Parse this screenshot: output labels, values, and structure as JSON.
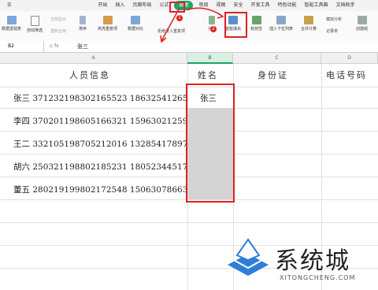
{
  "tabs": [
    "开始",
    "插入",
    "页面布局",
    "公式",
    "数据",
    "审阅",
    "视图",
    "安全",
    "开发工具",
    "特色功能",
    "智能工具箱",
    "文档助手"
  ],
  "active_tab": "数据",
  "ribbon": {
    "pivot": "数据透视表",
    "autofilter": "自动筛选",
    "show_all": "全部显示",
    "reapply": "重新应用",
    "sort": "排序",
    "highlight_dup": "高亮重复项",
    "data_compare": "数据对比",
    "reject_dup": "拒绝录入重复项",
    "split": "分列",
    "flash_fill": "智能填充",
    "validity": "有效性",
    "dropdown": "插入下拉列表",
    "merge_calc": "合并计算",
    "simulate": "模拟分析",
    "record": "记录单",
    "create_group": "创建组"
  },
  "formula_bar": {
    "cell_ref": "B2",
    "fx": "fx",
    "value": "张三"
  },
  "columns": [
    "A",
    "B",
    "C",
    "D"
  ],
  "headers": {
    "a": "人员信息",
    "b": "姓名",
    "c": "身份证",
    "d": "电话号码"
  },
  "rows": [
    {
      "info": "张三  371232198302165523  18632541265",
      "name": "张三"
    },
    {
      "info": "李四  370201198605166321  15963021259",
      "name": ""
    },
    {
      "info": "王二  332105198705212016  13285417897",
      "name": ""
    },
    {
      "info": "胡六  250321198802185231  18052344517",
      "name": ""
    },
    {
      "info": "董五  280219199802172548  15063078663",
      "name": ""
    }
  ],
  "markers": [
    "1",
    "2"
  ],
  "watermark": {
    "brand": "系统城",
    "url": "XITONGCHENG.COM"
  },
  "colors": {
    "accent": "#21a366",
    "highlight": "#e02020"
  }
}
